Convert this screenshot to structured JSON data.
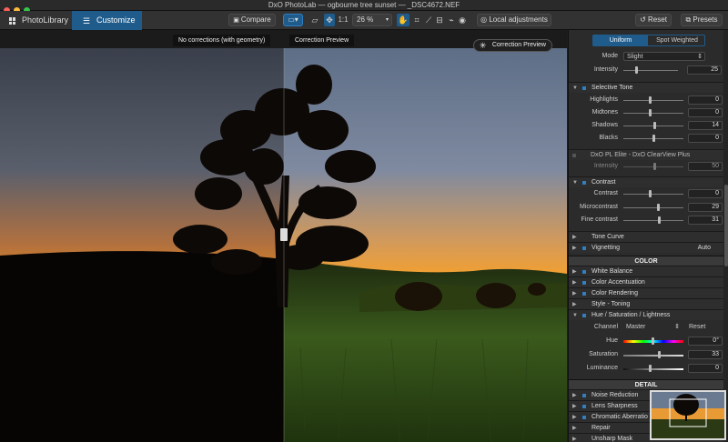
{
  "title": {
    "text": "DxO PhotoLab — ogbourne tree sunset — _DSC4672.NEF"
  },
  "toolbar": {
    "photolibrary": "PhotoLibrary",
    "customize": "Customize",
    "compare": "Compare",
    "one_to_one": "1:1",
    "zoom": "26 %",
    "local_adjustments": "Local adjustments",
    "reset": "Reset",
    "presets": "Presets"
  },
  "viewer": {
    "left_label": "No corrections (with geometry)",
    "right_label": "Correction Preview",
    "preview_badge": "Correction Preview"
  },
  "panel": {
    "seg_uniform": "Uniform",
    "seg_spot": "Spot Weighted",
    "mode_label": "Mode",
    "mode_value": "Slight",
    "intensity_label": "Intensity",
    "intensity_value": "25",
    "selective_tone": "Selective Tone",
    "highlights": {
      "label": "Highlights",
      "value": "0"
    },
    "midtones": {
      "label": "Midtones",
      "value": "0"
    },
    "shadows": {
      "label": "Shadows",
      "value": "14"
    },
    "blacks": {
      "label": "Blacks",
      "value": "0"
    },
    "clearview": "DxO PL Elite - DxO ClearView Plus",
    "cv_intensity": {
      "label": "Intensity",
      "value": "50"
    },
    "contrast_sec": "Contrast",
    "contrast": {
      "label": "Contrast",
      "value": "0"
    },
    "microcontrast": {
      "label": "Microcontrast",
      "value": "29"
    },
    "fine_contrast": {
      "label": "Fine contrast",
      "value": "31"
    },
    "tone_curve": "Tone Curve",
    "vignetting": "Vignetting",
    "vignetting_value": "Auto",
    "color_hdr": "COLOR",
    "white_balance": "White Balance",
    "color_accentuation": "Color Accentuation",
    "color_rendering": "Color Rendering",
    "style_toning": "Style - Toning",
    "hsl": "Hue / Saturation / Lightness",
    "channel_label": "Channel",
    "channel_value": "Master",
    "channel_reset": "Reset",
    "hue": {
      "label": "Hue",
      "value": "0°"
    },
    "saturation": {
      "label": "Saturation",
      "value": "33"
    },
    "luminance": {
      "label": "Luminance",
      "value": "0"
    },
    "detail_hdr": "DETAIL",
    "noise_reduction": "Noise Reduction",
    "lens_sharpness": "Lens Sharpness",
    "chromatic_aberration": "Chromatic Aberratio",
    "repair": "Repair",
    "unsharp_mask": "Unsharp Mask"
  },
  "colors": {
    "accent": "#1f5c8c",
    "accent_light": "#2f7fc1"
  }
}
